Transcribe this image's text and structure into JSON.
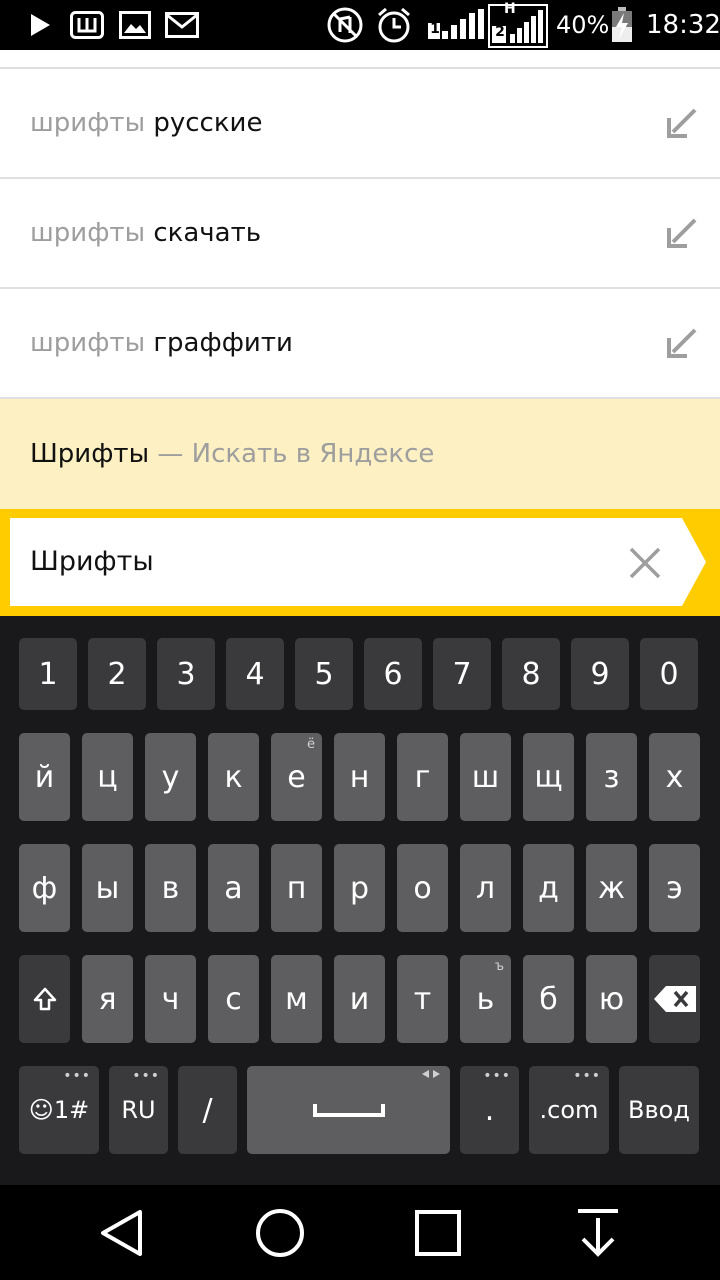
{
  "status_bar": {
    "battery_percent": "40%",
    "time": "18:32",
    "sim2_badge": "H",
    "sim2_number": "2",
    "sim1_number": "1"
  },
  "suggestions": [
    {
      "prefix": "шрифты",
      "suffix": "русские"
    },
    {
      "prefix": "шрифты",
      "suffix": "скачать"
    },
    {
      "prefix": "шрифты",
      "suffix": "граффити"
    }
  ],
  "yandex_suggestion": {
    "query": "Шрифты",
    "dash": "—",
    "action": "Искать в Яндексе"
  },
  "search": {
    "value": "Шрифты"
  },
  "keyboard": {
    "numbers": [
      "1",
      "2",
      "3",
      "4",
      "5",
      "6",
      "7",
      "8",
      "9",
      "0"
    ],
    "row1": [
      "й",
      "ц",
      "у",
      "к",
      "е",
      "н",
      "г",
      "ш",
      "щ",
      "з",
      "х"
    ],
    "row1_hint_e": "ё",
    "row2": [
      "ф",
      "ы",
      "в",
      "а",
      "п",
      "р",
      "о",
      "л",
      "д",
      "ж",
      "э"
    ],
    "row3": [
      "я",
      "ч",
      "с",
      "м",
      "и",
      "т",
      "ь",
      "б",
      "ю"
    ],
    "row3_hint_soft": "ъ",
    "emoji_label": "☺1#",
    "lang_label": "RU",
    "slash_label": "/",
    "period_label": ".",
    "dotcom_label": ".com",
    "enter_label": "Ввод",
    "more_dots": "•••"
  },
  "colors": {
    "accent_yellow": "#ffcc00",
    "suggestion_highlight": "#fdf1c3",
    "key_letter": "#5e5e60",
    "key_dark": "#3a3a3c",
    "keyboard_bg": "#19191c"
  }
}
